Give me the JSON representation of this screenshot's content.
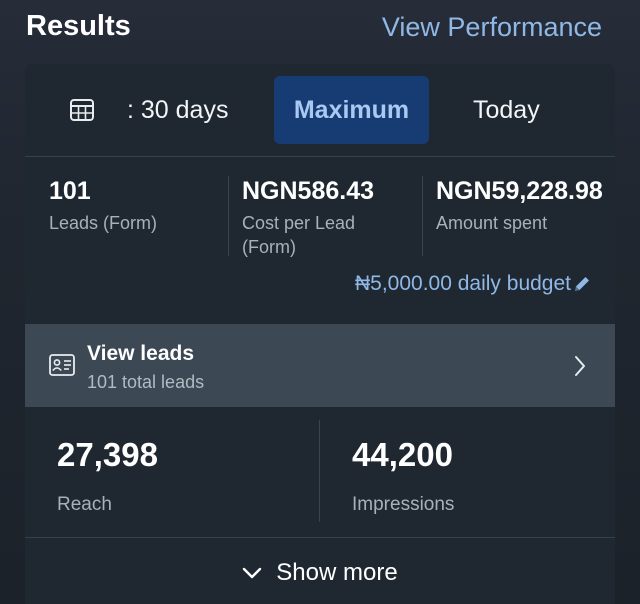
{
  "header": {
    "title": "Results",
    "view_performance": "View Performance"
  },
  "tabs": {
    "range_label": ": 30 days",
    "maximum_label": "Maximum",
    "today_label": "Today",
    "selected": "Maximum"
  },
  "metrics": [
    {
      "value": "101",
      "label": "Leads (Form)"
    },
    {
      "value": "NGN586.43",
      "label": "Cost per Lead (Form)"
    },
    {
      "value": "NGN59,228.98",
      "label": "Amount spent"
    }
  ],
  "budget": {
    "label": "₦5,000.00 daily budget",
    "icon": "pencil-icon"
  },
  "view_leads": {
    "title": "View leads",
    "subtitle": "101 total leads",
    "icon": "lead-card-icon"
  },
  "stats": [
    {
      "value": "27,398",
      "label": "Reach"
    },
    {
      "value": "44,200",
      "label": "Impressions"
    }
  ],
  "show_more": "Show more",
  "colors": {
    "accent_link": "#8fb8e6",
    "selected_tab_bg": "#173c73",
    "card_bg": "#1f2831",
    "view_leads_bg": "#3c4955"
  }
}
